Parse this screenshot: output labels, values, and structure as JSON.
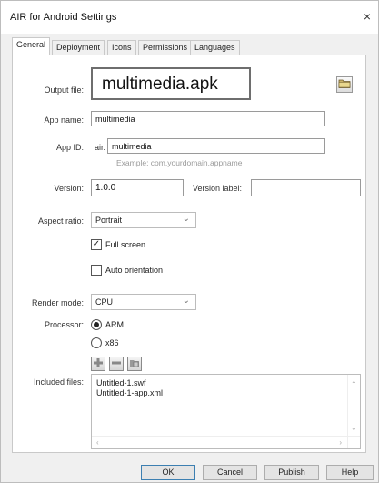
{
  "window": {
    "title": "AIR for Android Settings",
    "close_glyph": "×"
  },
  "tabs": [
    {
      "label": "General",
      "active": true
    },
    {
      "label": "Deployment",
      "active": false
    },
    {
      "label": "Icons",
      "active": false
    },
    {
      "label": "Permissions",
      "active": false
    },
    {
      "label": "Languages",
      "active": false
    }
  ],
  "general": {
    "output_file_label": "Output file:",
    "output_file_value": "multimedia.apk",
    "app_name_label": "App name:",
    "app_name_value": "multimedia",
    "app_id_label": "App ID:",
    "app_id_prefix": "air.",
    "app_id_value": "multimedia",
    "app_id_hint": "Example: com.yourdomain.appname",
    "version_label": "Version:",
    "version_value": "1.0.0",
    "version_label_label": "Version label:",
    "version_label_value": "",
    "aspect_ratio_label": "Aspect ratio:",
    "aspect_ratio_value": "Portrait",
    "full_screen_label": "Full screen",
    "full_screen_checked": true,
    "auto_orientation_label": "Auto orientation",
    "auto_orientation_checked": false,
    "render_mode_label": "Render mode:",
    "render_mode_value": "CPU",
    "processor_label": "Processor:",
    "processor_options": [
      "ARM",
      "x86"
    ],
    "processor_selected": "ARM",
    "included_files_label": "Included files:",
    "included_files": [
      "Untitled-1.swf",
      "Untitled-1-app.xml"
    ]
  },
  "buttons": {
    "ok": "OK",
    "cancel": "Cancel",
    "publish": "Publish",
    "help": "Help"
  },
  "icons": {
    "browse": "folder-icon",
    "add_file": "add-file-icon",
    "remove_file": "remove-file-icon",
    "add_folder": "add-folder-icon",
    "chevron": "chevron-down-icon"
  }
}
